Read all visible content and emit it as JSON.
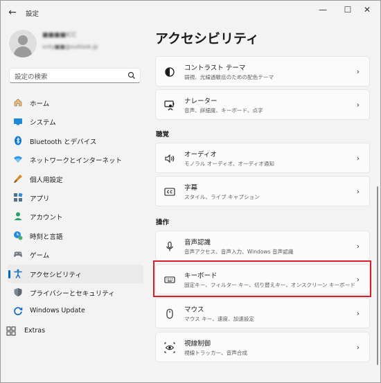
{
  "window": {
    "title": "設定",
    "back": "←",
    "minimize": "—",
    "maximize": "☐",
    "close": "✕"
  },
  "profile": {
    "name": "■■■■ICC",
    "email": "vnty■■@outlook.jp"
  },
  "search": {
    "placeholder": "設定の検索"
  },
  "sidebar": {
    "items": [
      {
        "label": "ホーム",
        "icon": "home-icon"
      },
      {
        "label": "システム",
        "icon": "system-icon"
      },
      {
        "label": "Bluetooth とデバイス",
        "icon": "bluetooth-icon"
      },
      {
        "label": "ネットワークとインターネット",
        "icon": "wifi-icon"
      },
      {
        "label": "個人用設定",
        "icon": "brush-icon"
      },
      {
        "label": "アプリ",
        "icon": "apps-icon"
      },
      {
        "label": "アカウント",
        "icon": "account-icon"
      },
      {
        "label": "時刻と言語",
        "icon": "clock-language-icon"
      },
      {
        "label": "ゲーム",
        "icon": "gamepad-icon"
      },
      {
        "label": "アクセシビリティ",
        "icon": "accessibility-icon",
        "active": true
      },
      {
        "label": "プライバシーとセキュリティ",
        "icon": "shield-icon"
      },
      {
        "label": "Windows Update",
        "icon": "update-icon"
      }
    ],
    "extras": "Extras"
  },
  "main": {
    "title": "アクセシビリティ",
    "cards_top": [
      {
        "title": "コントラスト テーマ",
        "desc": "弱視、光線過敏症のための配色テーマ",
        "icon": "contrast-icon"
      },
      {
        "title": "ナレーター",
        "desc": "音声、詳細度、キーボード、点字",
        "icon": "narrator-icon"
      }
    ],
    "section_hearing": "聴覚",
    "cards_hearing": [
      {
        "title": "オーディオ",
        "desc": "モノラル オーディオ、オーディオ通知",
        "icon": "speaker-icon"
      },
      {
        "title": "字幕",
        "desc": "スタイル、ライブ キャプション",
        "icon": "captions-icon"
      }
    ],
    "section_interaction": "操作",
    "cards_interaction": [
      {
        "title": "音声認識",
        "desc": "音声アクセス、音声入力、Windows 音声認識",
        "icon": "microphone-icon"
      },
      {
        "title": "キーボード",
        "desc": "固定キー、フィルター キー、切り替えキー、オンスクリーン キーボード",
        "icon": "keyboard-icon"
      },
      {
        "title": "マウス",
        "desc": "マウス キー、速度、加速設定",
        "icon": "mouse-icon"
      },
      {
        "title": "視線制御",
        "desc": "視線トラッカー、音声合成",
        "icon": "eye-control-icon"
      }
    ]
  },
  "colors": {
    "accent": "#0067c0",
    "highlight": "#d51f2b"
  }
}
